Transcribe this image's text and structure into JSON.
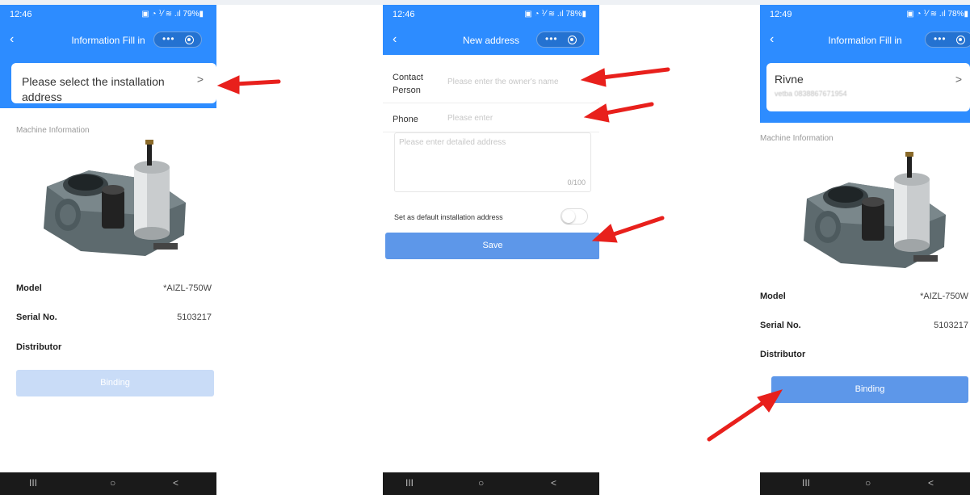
{
  "accent_color": "#2d8cff",
  "screens": [
    {
      "status": {
        "time": "12:46",
        "right": "▣ ◔ ⅟ ≋ .ıl 79%▮"
      },
      "nav": {
        "title": "Information Fill in",
        "dots": "•••"
      },
      "address_card": {
        "text": "Please select the installation address",
        "chevron": ">"
      },
      "machine_section": "Machine Information",
      "info": {
        "model_key": "Model",
        "model_val": "*AIZL-750W",
        "serial_key": "Serial No.",
        "serial_val": "5103217",
        "distributor_key": "Distributor"
      },
      "binding_button": "Binding",
      "sysnav": {
        "recents": "III",
        "home": "○",
        "back": "<"
      }
    },
    {
      "status": {
        "time": "12:46",
        "right": "▣ ◔ ⅟ ≋ .ıl 78%▮"
      },
      "nav": {
        "title": "New address",
        "dots": "•••"
      },
      "contact": {
        "label": "Contact Person",
        "placeholder": "Please enter the owner's name"
      },
      "phone": {
        "label": "Phone",
        "placeholder": "Please enter"
      },
      "detail": {
        "placeholder": "Please enter detailed address",
        "counter": "0/100"
      },
      "default_label": "Set as default installation address",
      "save_button": "Save",
      "sysnav": {
        "recents": "III",
        "home": "○",
        "back": "<"
      }
    },
    {
      "status": {
        "time": "12:49",
        "right": "▣ ◔ ⅟ ≋ .ıl 78%▮"
      },
      "nav": {
        "title": "Information Fill in",
        "dots": "•••"
      },
      "address_card": {
        "name": "Rivne",
        "sub": "vetba 0838867671954",
        "chevron": ">"
      },
      "machine_section": "Machine Information",
      "info": {
        "model_key": "Model",
        "model_val": "*AIZL-750W",
        "serial_key": "Serial No.",
        "serial_val": "5103217",
        "distributor_key": "Distributor"
      },
      "binding_button": "Binding",
      "sysnav": {
        "recents": "III",
        "home": "○",
        "back": "<"
      }
    }
  ]
}
